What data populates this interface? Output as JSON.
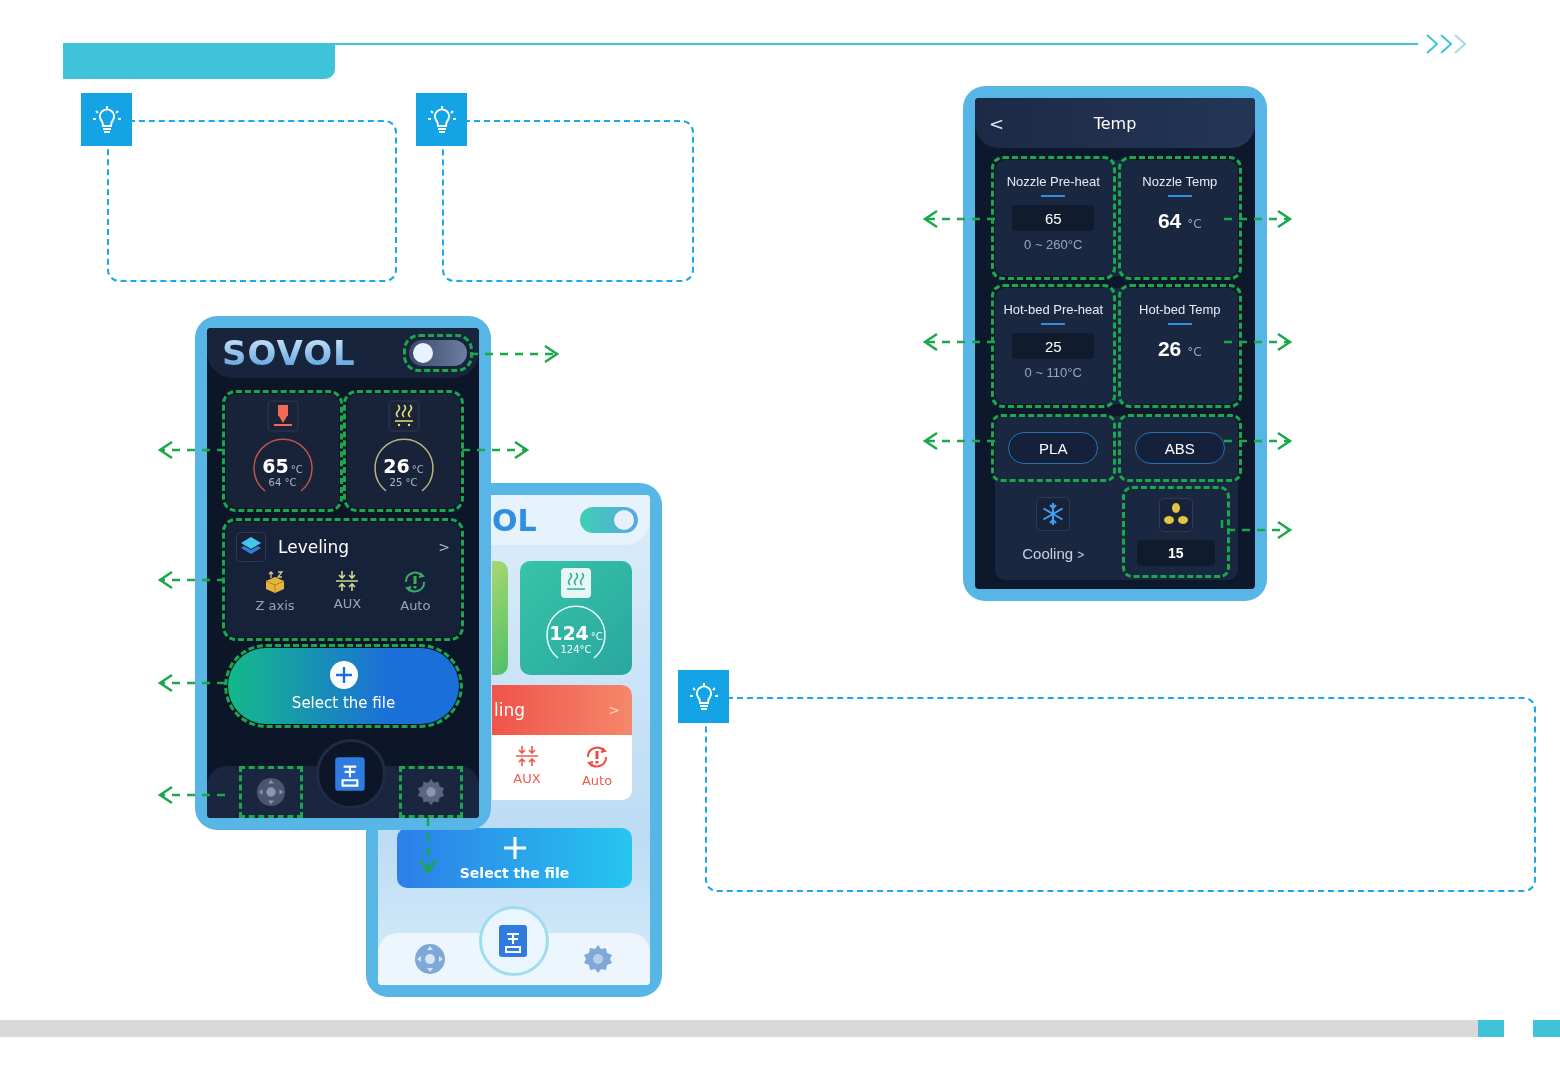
{
  "home_dark": {
    "logo": "SOVOL",
    "light_theme": false,
    "toggle_area": {
      "highlighted": true
    },
    "cards": [
      {
        "kind": "nozzle",
        "value": "65",
        "unit": "°C",
        "current": "64 °C",
        "highlighted": true
      },
      {
        "kind": "bed",
        "value": "26",
        "unit": "°C",
        "current": "25 °C",
        "highlighted": true
      }
    ],
    "leveling": {
      "title": "Leveling",
      "chevron": ">",
      "highlighted": true,
      "tools": [
        {
          "kind": "z_axis",
          "label": "Z axis"
        },
        {
          "kind": "aux",
          "label": "AUX"
        },
        {
          "kind": "auto",
          "label": "Auto"
        }
      ]
    },
    "select_file": {
      "label": "Select the file",
      "highlighted": true
    },
    "nav": [
      {
        "kind": "move",
        "highlighted": true
      },
      {
        "kind": "print",
        "highlighted": false
      },
      {
        "kind": "settings",
        "highlighted": true
      }
    ]
  },
  "home_light": {
    "logo": "OL",
    "light_theme": true,
    "bed_card": {
      "value": "124",
      "unit": "°C",
      "current": "124°C"
    },
    "leveling": {
      "title": "ling",
      "chevron": ">",
      "tools": [
        {
          "kind": "aux",
          "label": "AUX"
        },
        {
          "kind": "auto",
          "label": "Auto"
        }
      ]
    },
    "select_file": {
      "label": "Select the file"
    }
  },
  "temp_screen": {
    "back": "<",
    "title": "Temp",
    "rows": [
      [
        {
          "kind": "preheat",
          "title": "Nozzle Pre-heat",
          "value": "65",
          "range": "0 ~ 260°C",
          "highlighted": true
        },
        {
          "kind": "reading",
          "title": "Nozzle Temp",
          "value": "64",
          "unit": "°C",
          "highlighted": true
        }
      ],
      [
        {
          "kind": "preheat",
          "title": "Hot-bed Pre-heat",
          "value": "25",
          "range": "0 ~ 110°C",
          "highlighted": true
        },
        {
          "kind": "reading",
          "title": "Hot-bed Temp",
          "value": "26",
          "unit": "°C",
          "highlighted": true
        }
      ]
    ],
    "presets": [
      {
        "label": "PLA",
        "highlighted": true
      },
      {
        "label": "ABS",
        "highlighted": true
      }
    ],
    "cooling": {
      "label": "Cooling",
      "chevron": ">"
    },
    "fan": {
      "value": "15",
      "highlighted": true
    }
  }
}
